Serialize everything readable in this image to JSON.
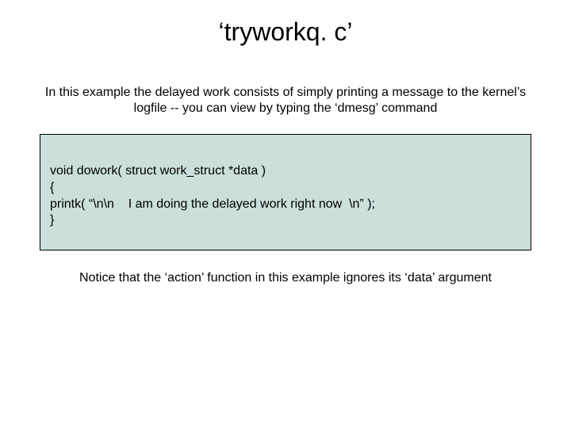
{
  "title": "‘tryworkq. c’",
  "intro": "In this example the delayed work consists of simply printing a message to the kernel’s logfile -- you can view by typing the ‘dmesg’ command",
  "code": {
    "l1": "void dowork( struct work_struct *data )",
    "l2": "{",
    "l3": "printk( “\\n\\n    I am doing the delayed work right now  \\n” );",
    "l4": "}"
  },
  "note": "Notice that the ‘action’ function in this example ignores its ‘data’ argument"
}
